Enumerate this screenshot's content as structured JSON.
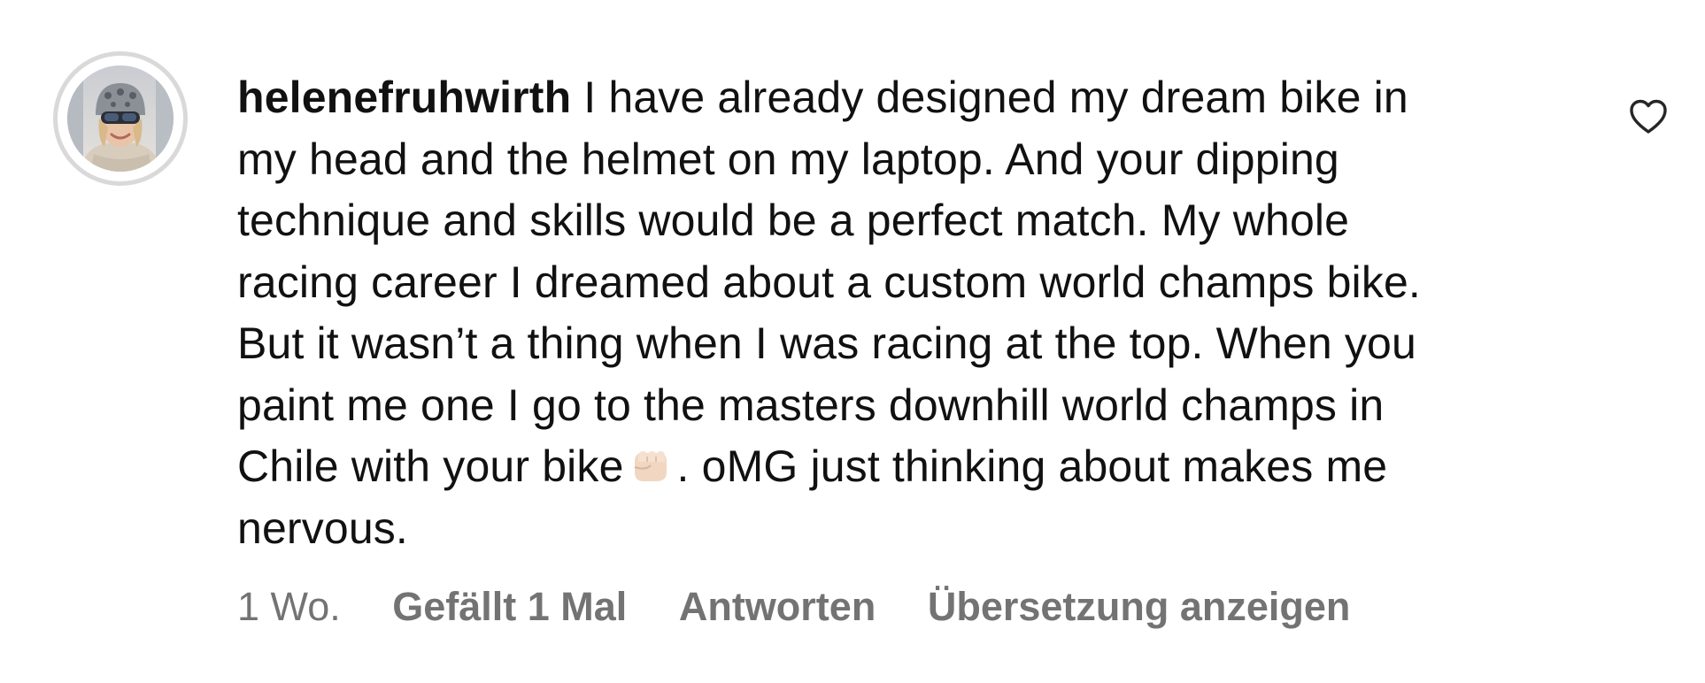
{
  "comment": {
    "username": "helenefruhwirth",
    "text_line1": "I have already designed my dream bike in\nmy head and the helmet on my laptop. And your dipping\ntechnique and skills would be a perfect match. My whole\nracing career I dreamed about a custom world champs bike.\nBut it wasn’t a thing when I was racing at the top. When you\npaint me one I go to the masters downhill world champs in\nChile with your bike",
    "emoji": "fist-bump-icon",
    "text_line2": ". oMG just thinking about makes me\nnervous.",
    "timestamp": "1 Wo.",
    "likes": "Gefällt 1 Mal",
    "reply": "Antworten",
    "translate": "Übersetzung anzeigen"
  },
  "colors": {
    "text": "#111111",
    "secondary": "#737373",
    "avatar_ring": "#d9d9d9"
  }
}
